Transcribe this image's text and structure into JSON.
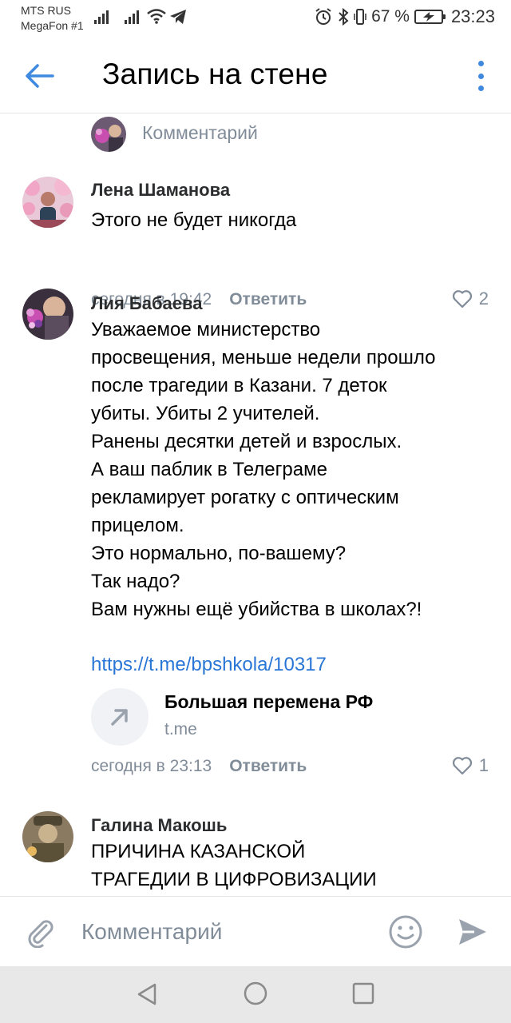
{
  "status_bar": {
    "carrier_1": "MTS RUS",
    "carrier_2": "MegaFon #1",
    "battery_percent": "67 %",
    "time": "23:23",
    "icons": [
      "signal-icon",
      "wifi-icon",
      "telegram-icon",
      "alarm-icon",
      "bluetooth-icon",
      "vibrate-icon",
      "battery-charging-icon"
    ]
  },
  "header": {
    "title": "Запись на стене",
    "back_icon": "arrow-left-icon",
    "menu_icon": "more-vertical-icon",
    "accent_color": "#3f8ae0"
  },
  "top_comment_prompt": {
    "placeholder": "Комментарий"
  },
  "comments": [
    {
      "author": "Лена Шаманова",
      "text": "Этого не будет никогда",
      "time": "сегодня в 19:42",
      "reply_label": "Ответить",
      "likes": "2"
    },
    {
      "author": "Лия Бабаева",
      "text": "Уважаемое министерство\nпросвещения, меньше недели прошло\nпосле трагедии в Казани. 7 деток\nубиты. Убиты 2 учителей.\nРанены десятки детей и взрослых.\nА ваш паблик в Телеграме\nрекламирует рогатку с оптическим\nприцелом.\nЭто нормально, по-вашему?\nТак надо?\nВам нужны ещё убийства в школах?!",
      "link": "https://t.me/bpshkola/10317",
      "snippet_title": "Большая перемена РФ",
      "snippet_domain": "t.me",
      "time": "сегодня в 23:13",
      "reply_label": "Ответить",
      "likes": "1"
    },
    {
      "author": "Галина Макошь",
      "text": "ПРИЧИНА КАЗАНСКОЙ\nТРАГЕДИИ В ЦИФРОВИЗАЦИИ"
    }
  ],
  "composer": {
    "placeholder": "Комментарий",
    "attach_icon": "paperclip-icon",
    "emoji_icon": "smile-icon",
    "send_icon": "send-icon"
  },
  "nav_bar": {
    "icons": [
      "nav-back-icon",
      "nav-home-icon",
      "nav-recent-icon"
    ]
  }
}
